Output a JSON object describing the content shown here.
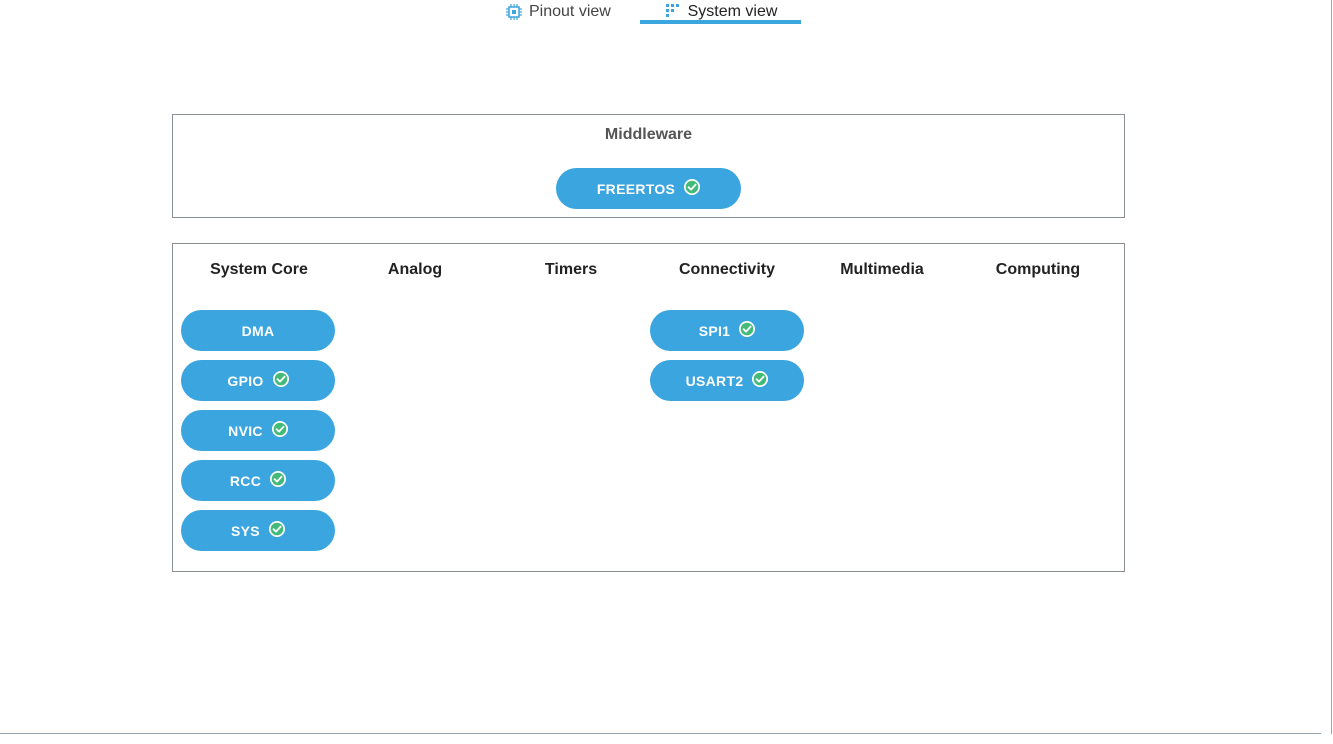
{
  "tabs": {
    "pinout_label": "Pinout view",
    "system_label": "System view"
  },
  "middleware": {
    "title": "Middleware",
    "items": [
      {
        "label": "FREERTOS",
        "configured": true
      }
    ]
  },
  "categories": {
    "columns": [
      {
        "title": "System Core"
      },
      {
        "title": "Analog"
      },
      {
        "title": "Timers"
      },
      {
        "title": "Connectivity"
      },
      {
        "title": "Multimedia"
      },
      {
        "title": "Computing"
      }
    ],
    "system_core": [
      {
        "label": "DMA",
        "configured": false
      },
      {
        "label": "GPIO",
        "configured": true
      },
      {
        "label": "NVIC",
        "configured": true
      },
      {
        "label": "RCC",
        "configured": true
      },
      {
        "label": "SYS",
        "configured": true
      }
    ],
    "connectivity": [
      {
        "label": "SPI1",
        "configured": true
      },
      {
        "label": "USART2",
        "configured": true
      }
    ]
  },
  "colors": {
    "accent": "#3aa5de",
    "check_bg": "#ffffff",
    "check_fg": "#2fb36b"
  }
}
